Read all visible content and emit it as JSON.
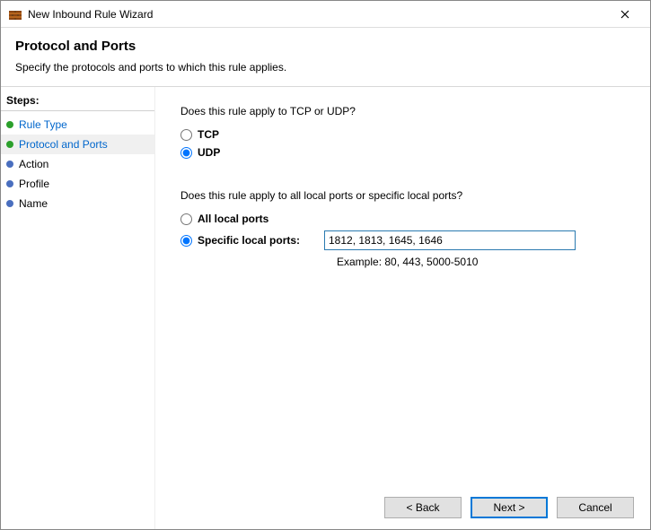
{
  "window": {
    "title": "New Inbound Rule Wizard"
  },
  "header": {
    "heading": "Protocol and Ports",
    "subtext": "Specify the protocols and ports to which this rule applies."
  },
  "sidebar": {
    "title": "Steps:",
    "steps": [
      {
        "label": "Rule Type"
      },
      {
        "label": "Protocol and Ports"
      },
      {
        "label": "Action"
      },
      {
        "label": "Profile"
      },
      {
        "label": "Name"
      }
    ]
  },
  "content": {
    "q1": "Does this rule apply to TCP or UDP?",
    "opt_tcp": "TCP",
    "opt_udp": "UDP",
    "q2": "Does this rule apply to all local ports or specific local ports?",
    "opt_all_ports": "All local ports",
    "opt_specific_ports": "Specific local ports:",
    "ports_value": "1812, 1813, 1645, 1646",
    "example": "Example: 80, 443, 5000-5010"
  },
  "footer": {
    "back": "< Back",
    "next": "Next >",
    "cancel": "Cancel"
  }
}
